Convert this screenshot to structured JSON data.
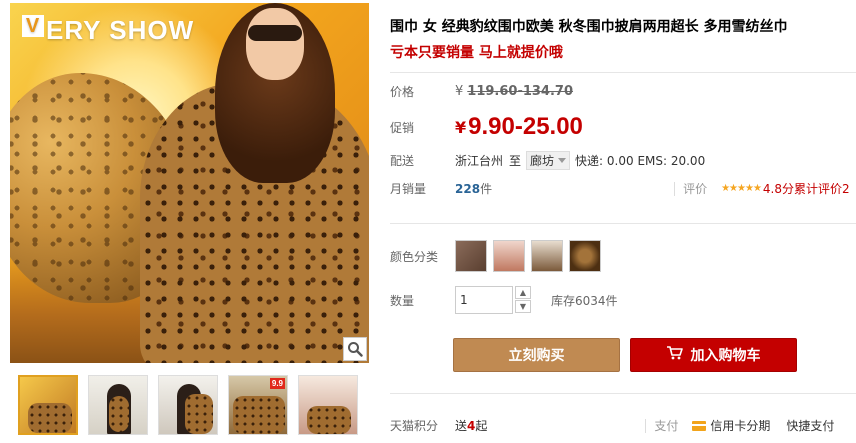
{
  "hero": {
    "logo_letter": "V",
    "logo_rest": "ERY SHOW"
  },
  "product": {
    "title": "围巾 女 经典豹纹围巾欧美 秋冬围巾披肩两用超长 多用雪纺丝巾",
    "subtitle": "亏本只要销量 马上就提价哦"
  },
  "price": {
    "label": "价格",
    "currency": "¥",
    "original": "119.60-134.70",
    "promo_label": "促销",
    "promo_currency": "¥",
    "promo": "9.90-25.00"
  },
  "shipping": {
    "label": "配送",
    "from": "浙江台州",
    "to_word": "至",
    "destination": "廊坊",
    "fees": "快递: 0.00 EMS: 20.00"
  },
  "sales": {
    "label": "月销量",
    "count": "228",
    "unit": "件",
    "rating_label": "评价",
    "stars": "★★★★★",
    "score": "4.8分",
    "review_text": "累计评价2"
  },
  "color": {
    "label": "颜色分类",
    "swatches": [
      "swatch-1",
      "swatch-2",
      "swatch-3",
      "swatch-4"
    ]
  },
  "quantity": {
    "label": "数量",
    "value": "1",
    "up": "▲",
    "down": "▼",
    "stock": "库存6034件"
  },
  "actions": {
    "buy_now": "立刻购买",
    "add_to_cart": "加入购物车"
  },
  "bottom": {
    "points_label": "天猫积分",
    "points_prefix": "送",
    "points_value": "4",
    "points_suffix": "起",
    "pay_label": "支付",
    "credit": "信用卡分期",
    "express_pay": "快捷支付"
  },
  "thumbs": {
    "badge": "9.9"
  },
  "icons": {
    "zoom": "magnifier-icon",
    "cart": "cart-icon",
    "card": "credit-card-icon"
  },
  "colors": {
    "accent_red": "#c40000",
    "buy_button": "#c08a52",
    "cart_button": "#c40000",
    "link_blue": "#2a6496",
    "star_orange": "#f5a623"
  }
}
